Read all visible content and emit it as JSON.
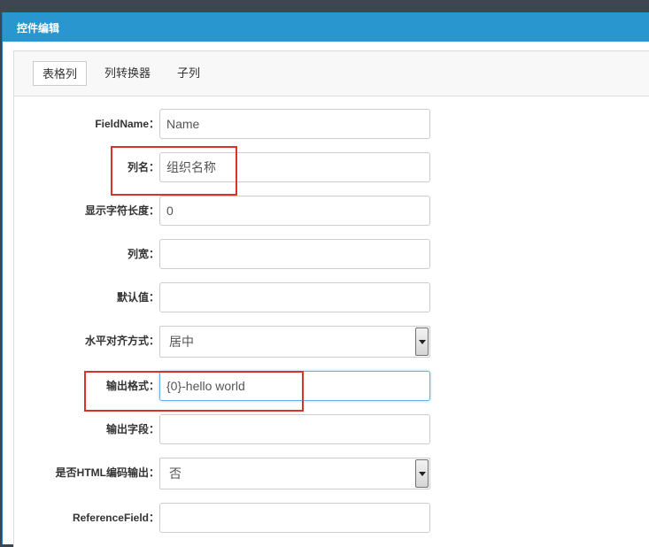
{
  "dialog": {
    "title": "控件编辑"
  },
  "tabs": [
    {
      "label": "表格列",
      "active": true
    },
    {
      "label": "列转换器",
      "active": false
    },
    {
      "label": "子列",
      "active": false
    }
  ],
  "fields": [
    {
      "label": "FieldName：",
      "type": "text",
      "value": "Name"
    },
    {
      "label": "列名：",
      "type": "text",
      "value": "组织名称"
    },
    {
      "label": "显示字符长度：",
      "type": "text",
      "value": "0"
    },
    {
      "label": "列宽：",
      "type": "text",
      "value": ""
    },
    {
      "label": "默认值：",
      "type": "text",
      "value": ""
    },
    {
      "label": "水平对齐方式：",
      "type": "select",
      "value": "居中"
    },
    {
      "label": "输出格式：",
      "type": "text",
      "value": "{0}-hello world",
      "focused": true
    },
    {
      "label": "输出字段：",
      "type": "text",
      "value": ""
    },
    {
      "label": "是否HTML编码输出：",
      "type": "select",
      "value": "否"
    },
    {
      "label": "ReferenceField：",
      "type": "text",
      "value": ""
    }
  ],
  "colors": {
    "header": "#2a96cf",
    "highlight": "#d9312b",
    "focus_border": "#66afe9"
  }
}
